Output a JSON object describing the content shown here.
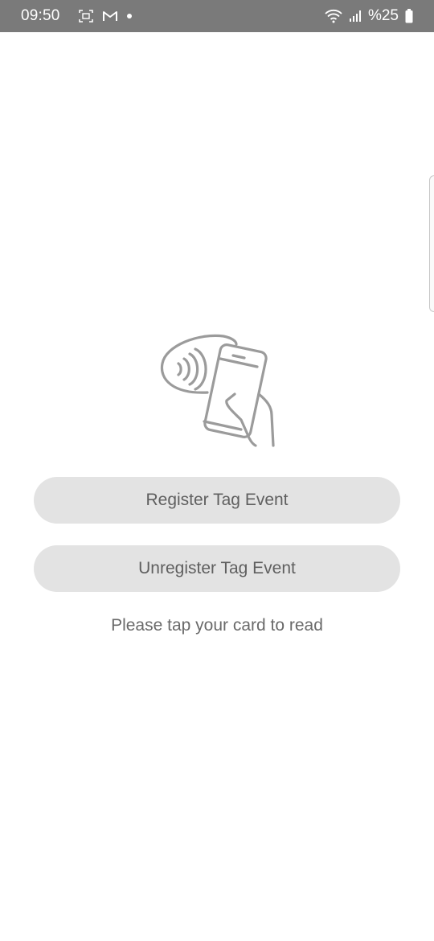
{
  "status_bar": {
    "time": "09:50",
    "battery_text": "%25",
    "icons": {
      "left": [
        "screenshot-icon",
        "gmail-icon",
        "notification-dot-icon"
      ],
      "right": [
        "wifi-icon",
        "cellular-signal-icon",
        "battery-icon"
      ]
    }
  },
  "main": {
    "illustration_icon": "nfc-tap-phone-icon",
    "register_button_label": "Register Tag Event",
    "unregister_button_label": "Unregister Tag Event",
    "status_message": "Please tap your card to read"
  },
  "colors": {
    "status_bar_bg": "#7a7a7a",
    "button_bg": "#e3e3e3",
    "button_text": "#5f5f5f",
    "illustration_stroke": "#9b9b9b"
  }
}
